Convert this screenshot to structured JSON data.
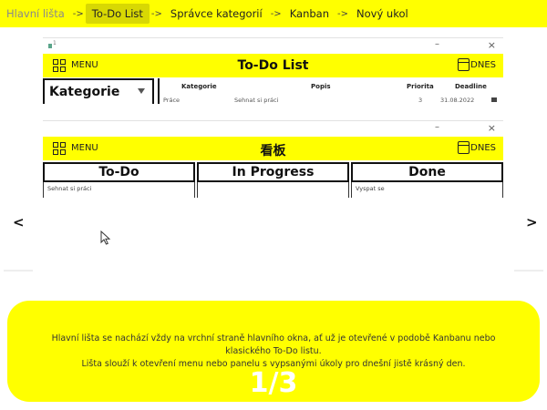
{
  "breadcrumb": {
    "items": [
      "Hlavní lišta",
      "To-Do List",
      "Správce kategorií",
      "Kanban",
      "Nový ukol"
    ],
    "separator": "->",
    "active_index": 1
  },
  "todo_window": {
    "app_number": "1",
    "minimize_glyph": "–",
    "close_glyph": "×",
    "menu_label": "MENU",
    "title": "To-Do List",
    "today_label": "DNES",
    "categories_label": "Kategorie",
    "columns": [
      "Kategorie",
      "Popis",
      "Priorita",
      "Deadline"
    ],
    "row": [
      "Práce",
      "Sehnat si práci",
      "3",
      "31.08.2022"
    ]
  },
  "kanban_window": {
    "minimize_glyph": "–",
    "close_glyph": "×",
    "menu_label": "MENU",
    "title": "看板",
    "today_label": "DNES",
    "columns": [
      {
        "name": "To-Do",
        "card": "Sehnat si práci"
      },
      {
        "name": "In Progress",
        "card": ""
      },
      {
        "name": "Done",
        "card": "Vyspat se"
      }
    ]
  },
  "nav": {
    "prev": "<",
    "next": ">"
  },
  "info": {
    "line1": "Hlavní lišta se nachází vždy na vrchní straně hlavního okna, ať už je otevřené v podobě Kanbanu nebo klasického To-Do listu.",
    "line2": "Lišta slouží k otevření menu nebo panelu s vypsanými úkoly pro dnešní jistě krásný den.",
    "counter": "1/3"
  },
  "colors": {
    "accent": "#ffff00",
    "active_crumb": "#d8d803"
  },
  "icons": [
    "grid-menu-icon",
    "calendar-icon",
    "filter-icon",
    "minimize-icon",
    "close-icon",
    "mouse-cursor-icon"
  ]
}
